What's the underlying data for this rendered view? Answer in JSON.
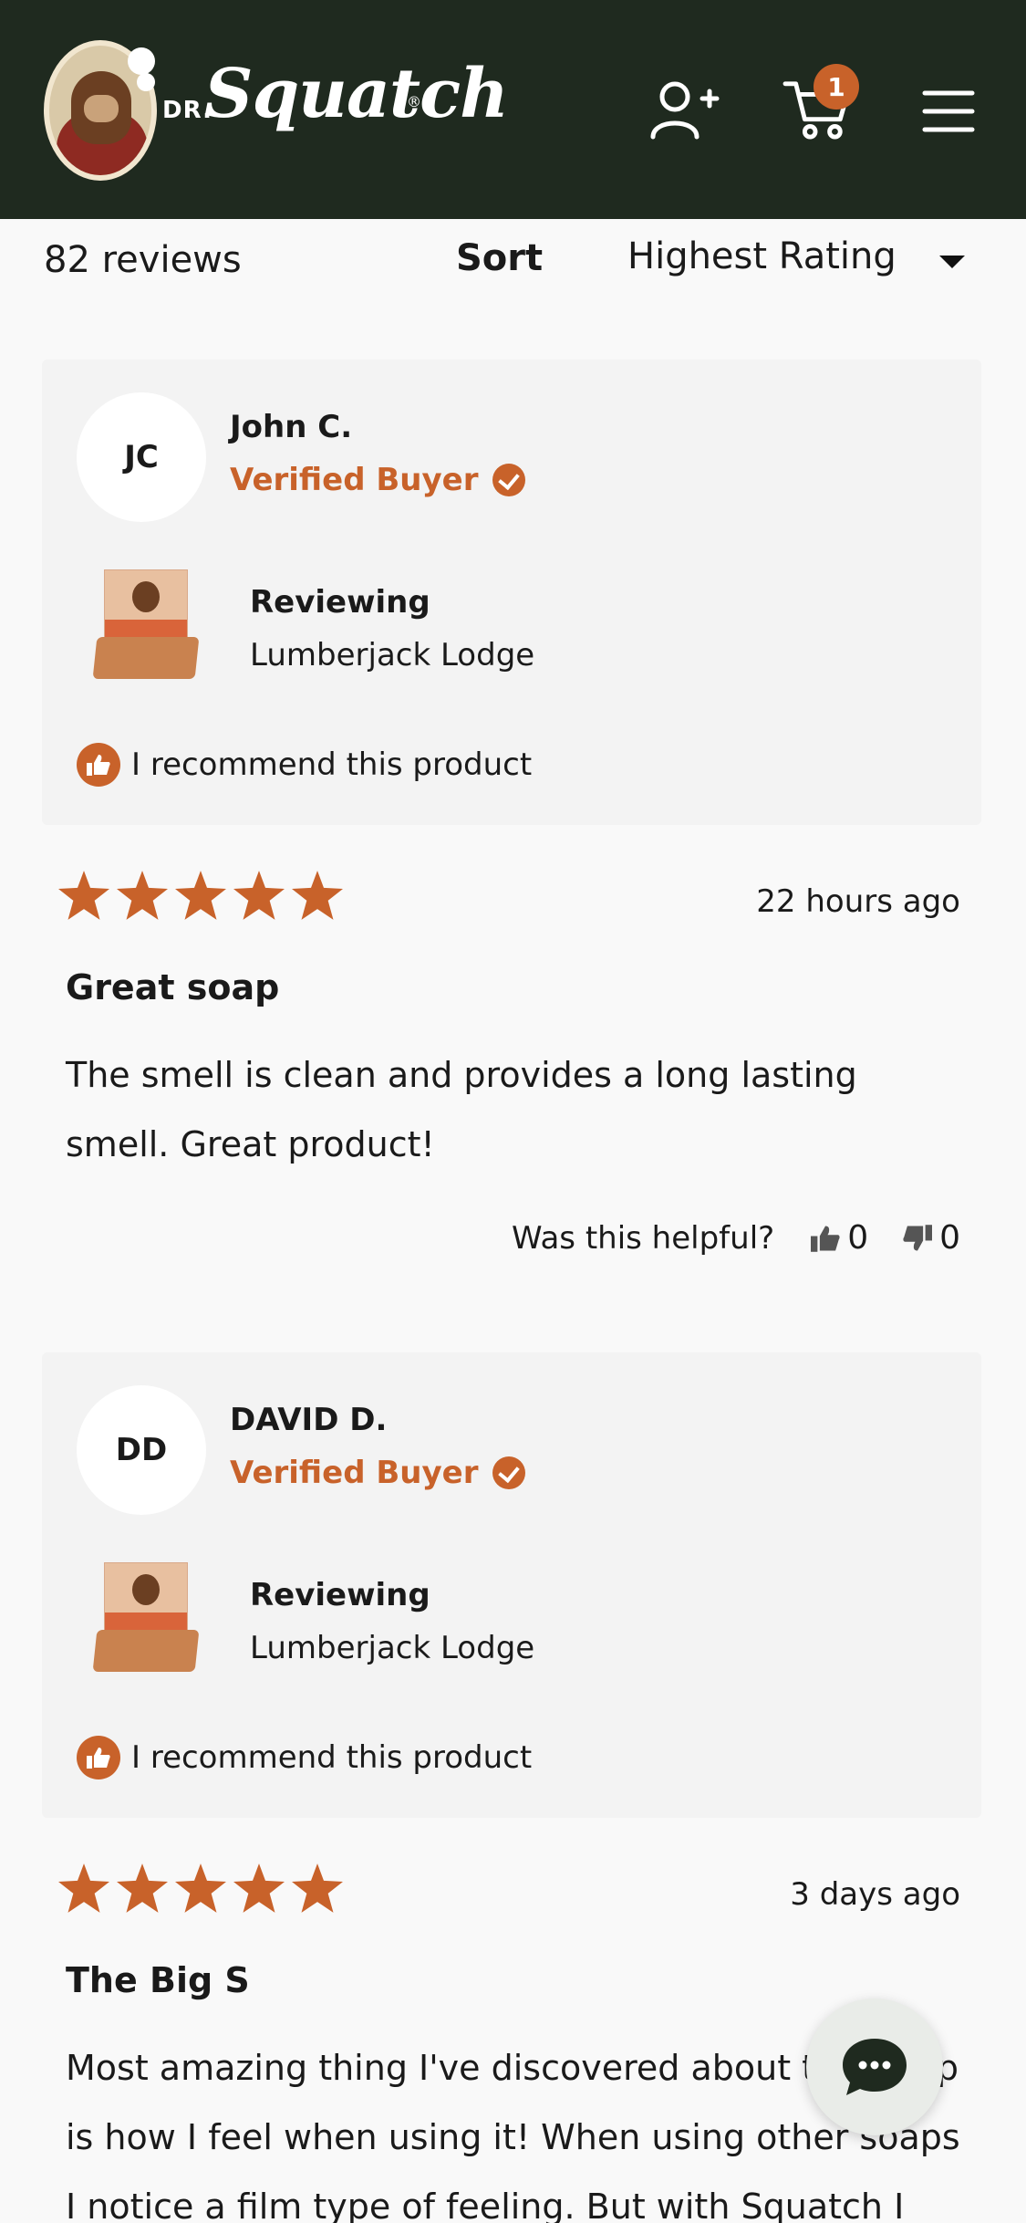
{
  "header": {
    "brand_prefix": "DR.",
    "brand_name": "Squatch",
    "brand_reg": "®",
    "cart_count": "1",
    "bg_color": "#1f2a1f",
    "accent_color": "#c8622a"
  },
  "sort_bar": {
    "review_count": "82 reviews",
    "sort_label": "Sort",
    "sort_value": "Highest Rating"
  },
  "reviews": [
    {
      "initials": "JC",
      "name": "John C.",
      "verified": "Verified Buyer",
      "reviewing_label": "Reviewing",
      "product": "Lumberjack Lodge",
      "recommend": "I recommend this product",
      "rating": 5,
      "date": "22 hours ago",
      "title": "Great soap",
      "body": "The smell is clean and provides a long lasting smell. Great product!",
      "helpful_question": "Was this helpful?",
      "helpful_yes": "0",
      "helpful_no": "0"
    },
    {
      "initials": "DD",
      "name": "DAVID D.",
      "verified": "Verified Buyer",
      "reviewing_label": "Reviewing",
      "product": "Lumberjack Lodge",
      "recommend": "I recommend this product",
      "rating": 5,
      "date": "3 days ago",
      "title": "The Big S",
      "body": "Most amazing thing I've discovered about this soap is how I feel when using it! When using other soaps I notice a film type of feeling. But with Squatch I"
    }
  ],
  "icons": {
    "account": "account-add-icon",
    "cart": "cart-icon",
    "menu": "hamburger-menu-icon",
    "chat": "chat-bubble-icon"
  }
}
